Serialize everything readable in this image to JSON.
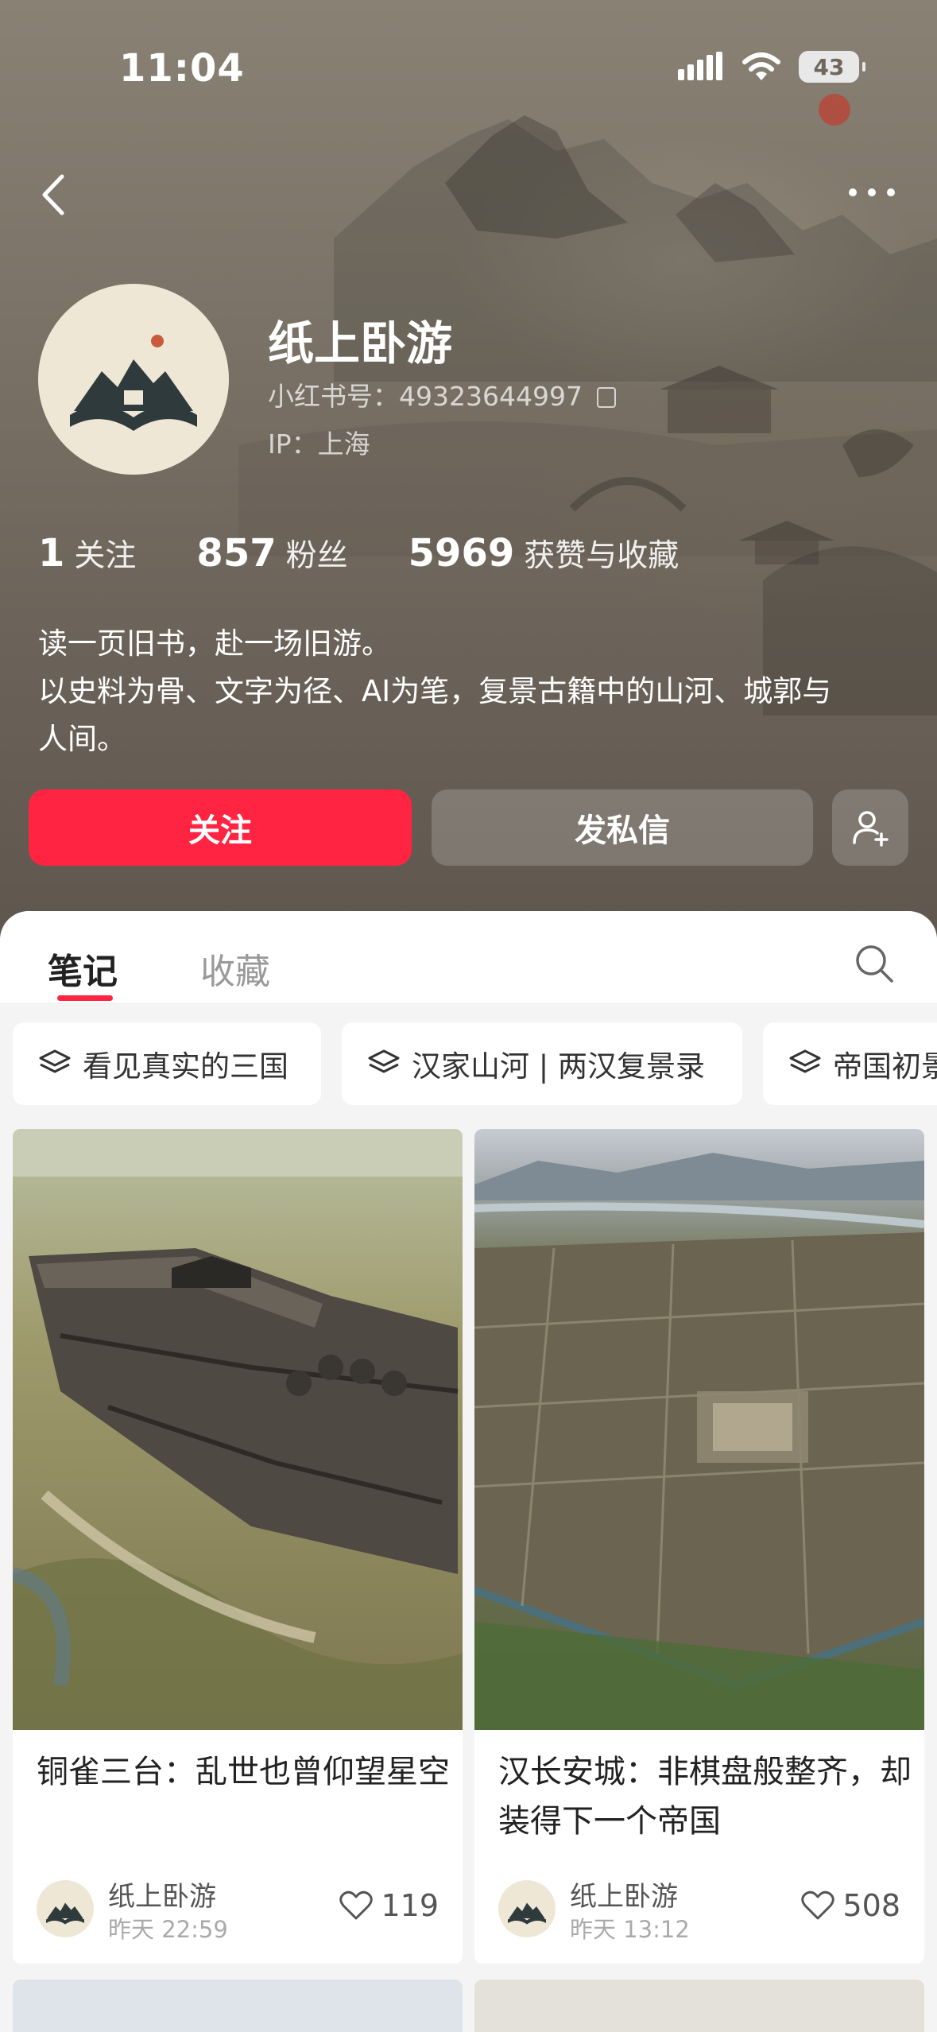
{
  "status_bar": {
    "time": "11:04",
    "battery": "43"
  },
  "profile": {
    "nickname": "纸上卧游",
    "red_id": "小红书号：49323644997",
    "ip": "IP：上海",
    "stats": [
      {
        "value": "1",
        "label": "关注"
      },
      {
        "value": "857",
        "label": "粉丝"
      },
      {
        "value": "5969",
        "label": "获赞与收藏"
      }
    ],
    "bio_lines": [
      "读一页旧书，赴一场旧游。",
      "以史料为骨、文字为径、AI为笔，复景古籍中的山河、城郭与",
      "人间。"
    ]
  },
  "actions": {
    "follow": "关注",
    "message": "发私信"
  },
  "tabs": [
    {
      "label": "笔记",
      "active": true
    },
    {
      "label": "收藏",
      "active": false
    }
  ],
  "collections": [
    "看见真实的三国",
    "汉家山河 | 两汉复景录",
    "帝国初景"
  ],
  "notes": [
    {
      "title": "铜雀三台：乱世也曾仰望星空",
      "author": "纸上卧游",
      "time": "昨天 22:59",
      "likes": "119"
    },
    {
      "title": "汉长安城：非棋盘般整齐，却装得下一个帝国",
      "author": "纸上卧游",
      "time": "昨天 13:12",
      "likes": "508"
    }
  ],
  "colors": {
    "accent": "#ff2442",
    "header_bg": "#7a7266"
  }
}
